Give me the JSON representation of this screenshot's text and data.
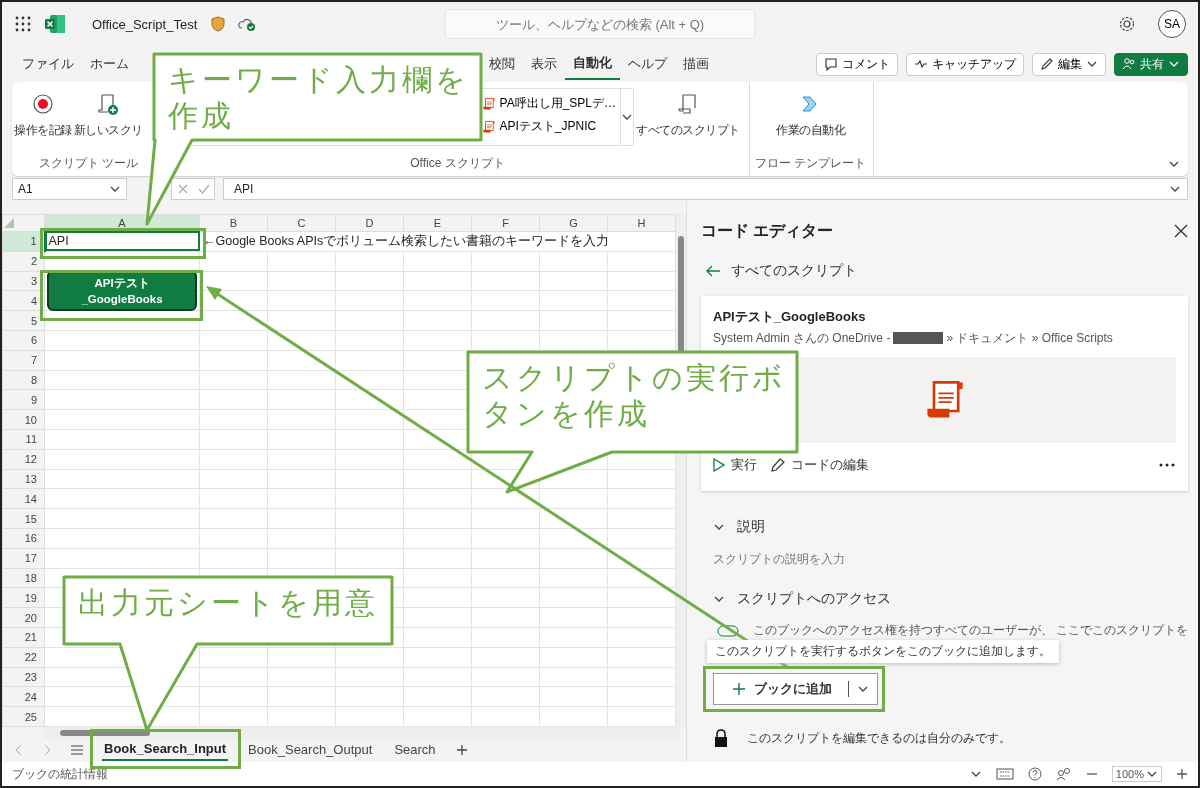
{
  "title_bar": {
    "file_name": "Office_Script_Test",
    "search": {
      "placeholder": "ツール、ヘルプなどの検索 (Alt + Q)"
    },
    "avatar": "SA"
  },
  "ribbon_tabs": [
    {
      "label": "ファイル",
      "selected": false
    },
    {
      "label": "ホーム",
      "selected": false
    },
    {
      "label": "校閲",
      "selected": false
    },
    {
      "label": "表示",
      "selected": false
    },
    {
      "label": "自動化",
      "selected": true
    },
    {
      "label": "ヘルプ",
      "selected": false
    },
    {
      "label": "描画",
      "selected": false
    }
  ],
  "header_buttons": [
    {
      "label": "コメント",
      "kind": "comment"
    },
    {
      "label": "キャッチアップ",
      "kind": "catchup"
    },
    {
      "label": "編集",
      "kind": "edit"
    },
    {
      "label": "共有",
      "kind": "share"
    }
  ],
  "ribbon": {
    "script_tools": {
      "label": "スクリプト ツール",
      "buttons": [
        {
          "label": "操作を記録",
          "kind": "record"
        },
        {
          "label": "新しいスクリ",
          "kind": "new"
        }
      ]
    },
    "office_scripts": {
      "label": "Office スクリプト",
      "gallery": [
        "PA呼出し用_SPLデ…",
        "APIテスト_JPNIC"
      ],
      "all_scripts": "すべてのスクリプト"
    },
    "flow_templates": {
      "label": "フロー テンプレート",
      "button": "作業の自動化"
    }
  },
  "formula_bar": {
    "name_box": "A1",
    "value": "API"
  },
  "sheet": {
    "columns": [
      "A",
      "B",
      "C",
      "D",
      "E",
      "F",
      "G",
      "H"
    ],
    "rows": [
      {
        "header": "1",
        "cells": [
          {
            "text": "API",
            "selected": true
          },
          {
            "text": "←Google Books APIsでボリューム検索したい書籍のキーワードを入力",
            "selected": false
          }
        ]
      },
      {
        "header": "2"
      },
      {
        "header": "3"
      },
      {
        "header": "4"
      },
      {
        "header": "5"
      },
      {
        "header": "6"
      },
      {
        "header": "7"
      },
      {
        "header": "8"
      },
      {
        "header": "9"
      },
      {
        "header": "10"
      },
      {
        "header": "11"
      },
      {
        "header": "12"
      },
      {
        "header": "13"
      },
      {
        "header": "14"
      },
      {
        "header": "15"
      },
      {
        "header": "16"
      },
      {
        "header": "17"
      },
      {
        "header": "18"
      },
      {
        "header": "19"
      },
      {
        "header": "20"
      },
      {
        "header": "21"
      },
      {
        "header": "22"
      },
      {
        "header": "23"
      },
      {
        "header": "24"
      },
      {
        "header": "25"
      }
    ]
  },
  "shape_button": {
    "label": "APIテスト\n_GoogleBooks"
  },
  "sheet_tabs": [
    {
      "label": "Book_Search_Input",
      "selected": true
    },
    {
      "label": "Book_Search_Output",
      "selected": false
    },
    {
      "label": "Search",
      "selected": false
    }
  ],
  "status_bar": {
    "text": "ブックの統計情報",
    "zoom": "100%"
  },
  "code_editor": {
    "title": "コード エディター",
    "back_link": "すべてのスクリプト",
    "script": {
      "name": "APIテスト_GoogleBooks",
      "path_owner": "System Admin さんの OneDrive -",
      "path_rest": "» ドキュメント » Office Scripts",
      "actions": [
        {
          "label": "実行",
          "kind": "run"
        },
        {
          "label": "コードの編集",
          "kind": "edit"
        }
      ]
    },
    "description": {
      "title": "説明",
      "expanded": true,
      "placeholder": "スクリプトの説明を入力"
    },
    "access": {
      "title": "スクリプトへのアクセス",
      "expanded": true,
      "toggle_text": "このブックへのアクセス権を持つすべてのユーザーが、 ここでこのスクリプトを",
      "tooltip": "このスクリプトを実行するボタンをこのブックに追加します。",
      "add_button": "ブックに追加",
      "lock_note": "このスクリプトを編集できるのは自分のみです。"
    }
  },
  "callouts": [
    {
      "text": "キーワード入力欄を作成"
    },
    {
      "text": "スクリプトの実行ボタンを作成"
    },
    {
      "text": "出力元シートを用意"
    }
  ]
}
